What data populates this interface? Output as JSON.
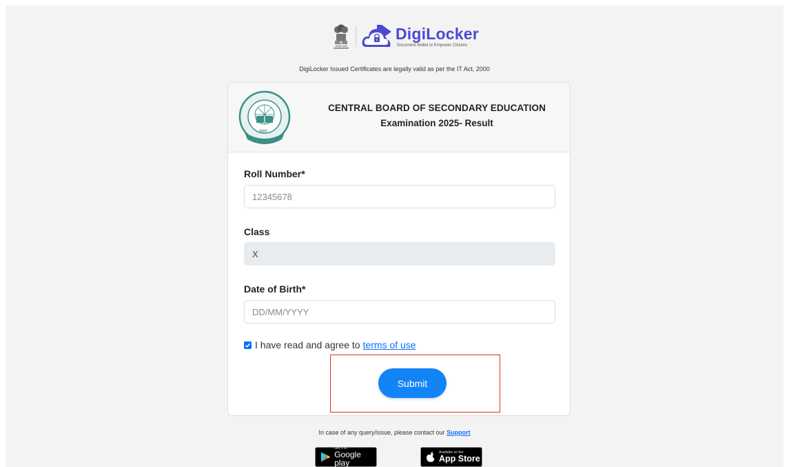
{
  "brand": {
    "emblem_text": "सत्यमेव जयते",
    "name": "DigiLocker",
    "tagline": "Document Wallet to Empower Citizens",
    "legal_note": "DigiLocker Issued Certificates are legally valid as per the IT Act, 2000",
    "accent_color": "#4c4ad0"
  },
  "card": {
    "logo_text_top": "केन्द्रीय माध्यमिक शिक्षा बोर्ड",
    "logo_text_mid": "भारत",
    "logo_text_bottom": "असतो मा सद्गमय",
    "board_title": "CENTRAL BOARD OF SECONDARY EDUCATION",
    "exam_title": "Examination 2025- Result"
  },
  "form": {
    "roll_label": "Roll Number*",
    "roll_placeholder": "12345678",
    "class_label": "Class",
    "class_value": "X",
    "dob_label": "Date of Birth*",
    "dob_placeholder": "DD/MM/YYYY",
    "agree_checked": true,
    "agree_text": "I have read and agree to",
    "agree_link": "terms of use",
    "submit_label": "Submit",
    "primary_color": "#1284f5"
  },
  "footer": {
    "support_text": "In case of any query/issue, please contact our",
    "support_link": "Support",
    "google_play_small": "Get it on",
    "google_play_big": "Google play",
    "app_store_small": "Available on the",
    "app_store_big": "App Store"
  },
  "icons": [
    "national-emblem-icon",
    "digilocker-cloud-icon",
    "cbse-logo-icon",
    "checkbox-checked-icon",
    "play-store-icon",
    "apple-icon"
  ]
}
